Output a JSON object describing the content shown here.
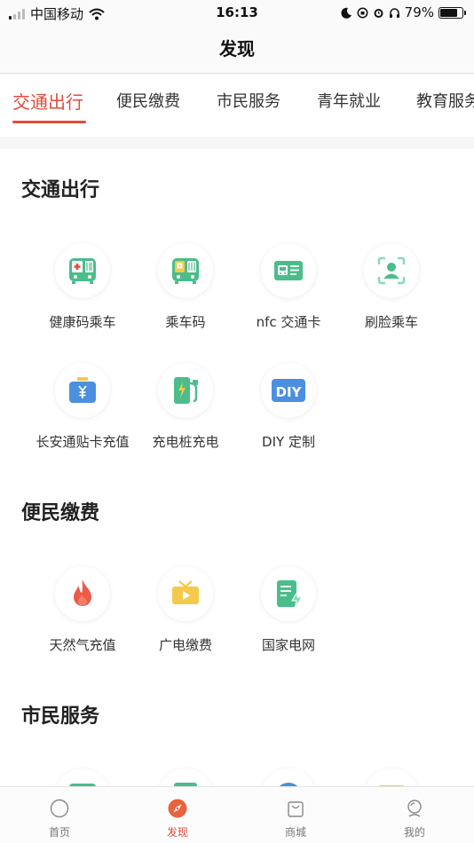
{
  "status_bar": {
    "carrier": "中国移动",
    "time": "16:13",
    "battery": "79%",
    "battery_level": 0.79
  },
  "header": {
    "title": "发现"
  },
  "tabs": [
    {
      "label": "交通出行",
      "active": true
    },
    {
      "label": "便民缴费",
      "active": false
    },
    {
      "label": "市民服务",
      "active": false
    },
    {
      "label": "青年就业",
      "active": false
    },
    {
      "label": "教育服务",
      "active": false
    }
  ],
  "sections": [
    {
      "title": "交通出行",
      "items": [
        {
          "label": "健康码乘车",
          "icon": "health-code-bus-icon"
        },
        {
          "label": "乘车码",
          "icon": "bus-qr-code-icon"
        },
        {
          "label": "nfc 交通卡",
          "icon": "nfc-transit-card-icon"
        },
        {
          "label": "刷脸乘车",
          "icon": "face-scan-icon"
        },
        {
          "label": "长安通贴卡充值",
          "icon": "card-recharge-icon"
        },
        {
          "label": "充电桩充电",
          "icon": "charging-pile-icon"
        },
        {
          "label": "DIY 定制",
          "icon": "diy-icon"
        }
      ]
    },
    {
      "title": "便民缴费",
      "items": [
        {
          "label": "天然气充值",
          "icon": "flame-icon"
        },
        {
          "label": "广电缴费",
          "icon": "tv-icon"
        },
        {
          "label": "国家电网",
          "icon": "power-grid-icon"
        }
      ]
    },
    {
      "title": "市民服务",
      "items": []
    }
  ],
  "tabbar": [
    {
      "label": "首页",
      "icon": "home-icon",
      "active": false
    },
    {
      "label": "发现",
      "icon": "compass-icon",
      "active": true
    },
    {
      "label": "商城",
      "icon": "shop-bag-icon",
      "active": false
    },
    {
      "label": "我的",
      "icon": "profile-icon",
      "active": false
    }
  ],
  "colors": {
    "accent": "#e04c3c",
    "green": "#4bbd8b",
    "blue": "#4a8fe0",
    "yellow": "#f5c94b"
  }
}
